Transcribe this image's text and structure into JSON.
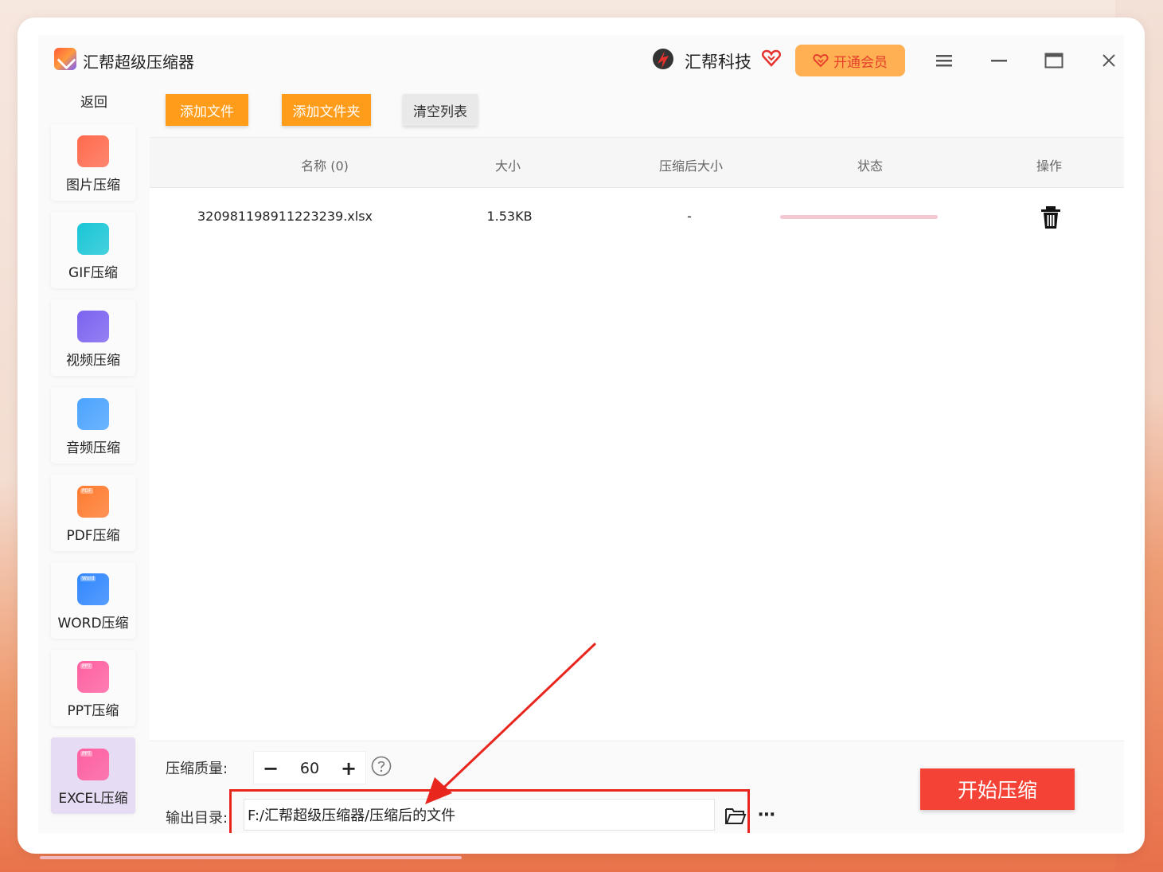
{
  "titlebar": {
    "app_title": "汇帮超级压缩器",
    "brand_name": "汇帮科技",
    "vip_label": "开通会员",
    "icons": [
      "logo-icon",
      "brand-logo-icon",
      "heart-icon",
      "menu-icon",
      "minimize-icon",
      "maximize-icon",
      "close-icon"
    ]
  },
  "sidebar": {
    "back_label": "返回",
    "items": [
      {
        "label": "图片压缩",
        "icon": "image-icon",
        "color": "#ff6a4d"
      },
      {
        "label": "GIF压缩",
        "icon": "gif-icon",
        "color": "#19c6d6"
      },
      {
        "label": "视频压缩",
        "icon": "video-icon",
        "color": "#7c62f0"
      },
      {
        "label": "音频压缩",
        "icon": "audio-icon",
        "color": "#4aa3ff"
      },
      {
        "label": "PDF压缩",
        "icon": "pdf-icon",
        "color": "#ff7a2e",
        "tag": "PDF"
      },
      {
        "label": "WORD压缩",
        "icon": "word-icon",
        "color": "#2f86ff",
        "tag": "Word"
      },
      {
        "label": "PPT压缩",
        "icon": "ppt-icon",
        "color": "#ff5fa0",
        "tag": "PPT"
      },
      {
        "label": "EXCEL压缩",
        "icon": "excel-icon",
        "color": "#ff5fa0",
        "tag": "PPT",
        "active": true
      }
    ]
  },
  "toolbar": {
    "add_file": "添加文件",
    "add_folder": "添加文件夹",
    "clear_list": "清空列表"
  },
  "table": {
    "columns": [
      "名称 (0)",
      "大小",
      "压缩后大小",
      "状态",
      "操作"
    ],
    "rows": [
      {
        "name": "320981198911223239.xlsx",
        "size": "1.53KB",
        "compressed_size": "-"
      }
    ]
  },
  "bottom": {
    "quality_label": "压缩质量:",
    "quality_value": "60",
    "output_label": "输出目录:",
    "output_path": "F:/汇帮超级压缩器/压缩后的文件",
    "start_label": "开始压缩"
  },
  "colors": {
    "accent_orange": "#ff9c1a",
    "start_red": "#f44336",
    "highlight_red": "#e8261e",
    "vip_bg": "#ffb052"
  }
}
